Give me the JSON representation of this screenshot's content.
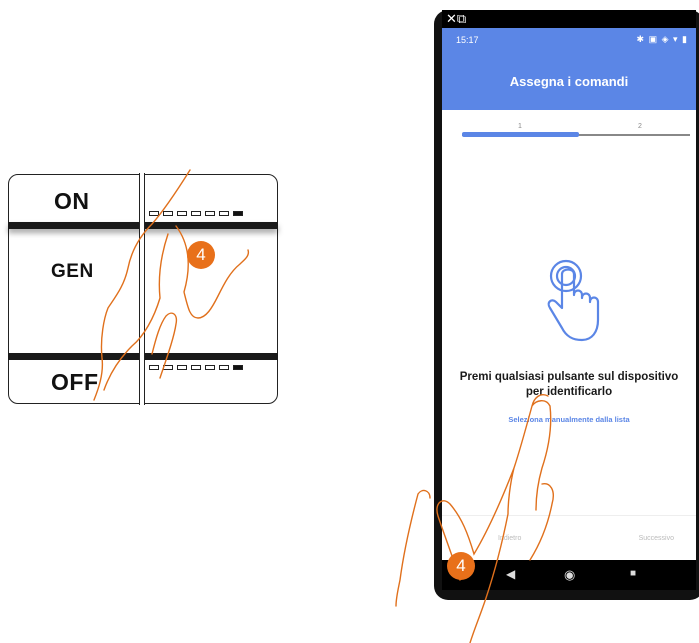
{
  "switch": {
    "label_on": "ON",
    "label_gen": "GEN",
    "label_off": "OFF",
    "step_badge": "4"
  },
  "phone": {
    "status_time": "15:17",
    "status_icons": "✱ ▣ ◈ ▾ ▮",
    "screen_title": "Assegna i comandi",
    "step_1": "1",
    "step_2": "2",
    "instruction": "Premi qualsiasi pulsante sul dispositivo per identificarlo",
    "select_manually_link": "Seleziona manualmente dalla lista",
    "prev_button": "Indietro",
    "next_button": "Successivo",
    "step_badge": "4"
  },
  "colors": {
    "accent_blue": "#5b86e6",
    "badge_orange": "#e8701a",
    "hand_outline": "#e0701c"
  },
  "icons": [
    "tap-gesture-icon",
    "back-nav-icon",
    "home-nav-icon",
    "recent-apps-icon",
    "close-icon",
    "external-link-icon"
  ]
}
